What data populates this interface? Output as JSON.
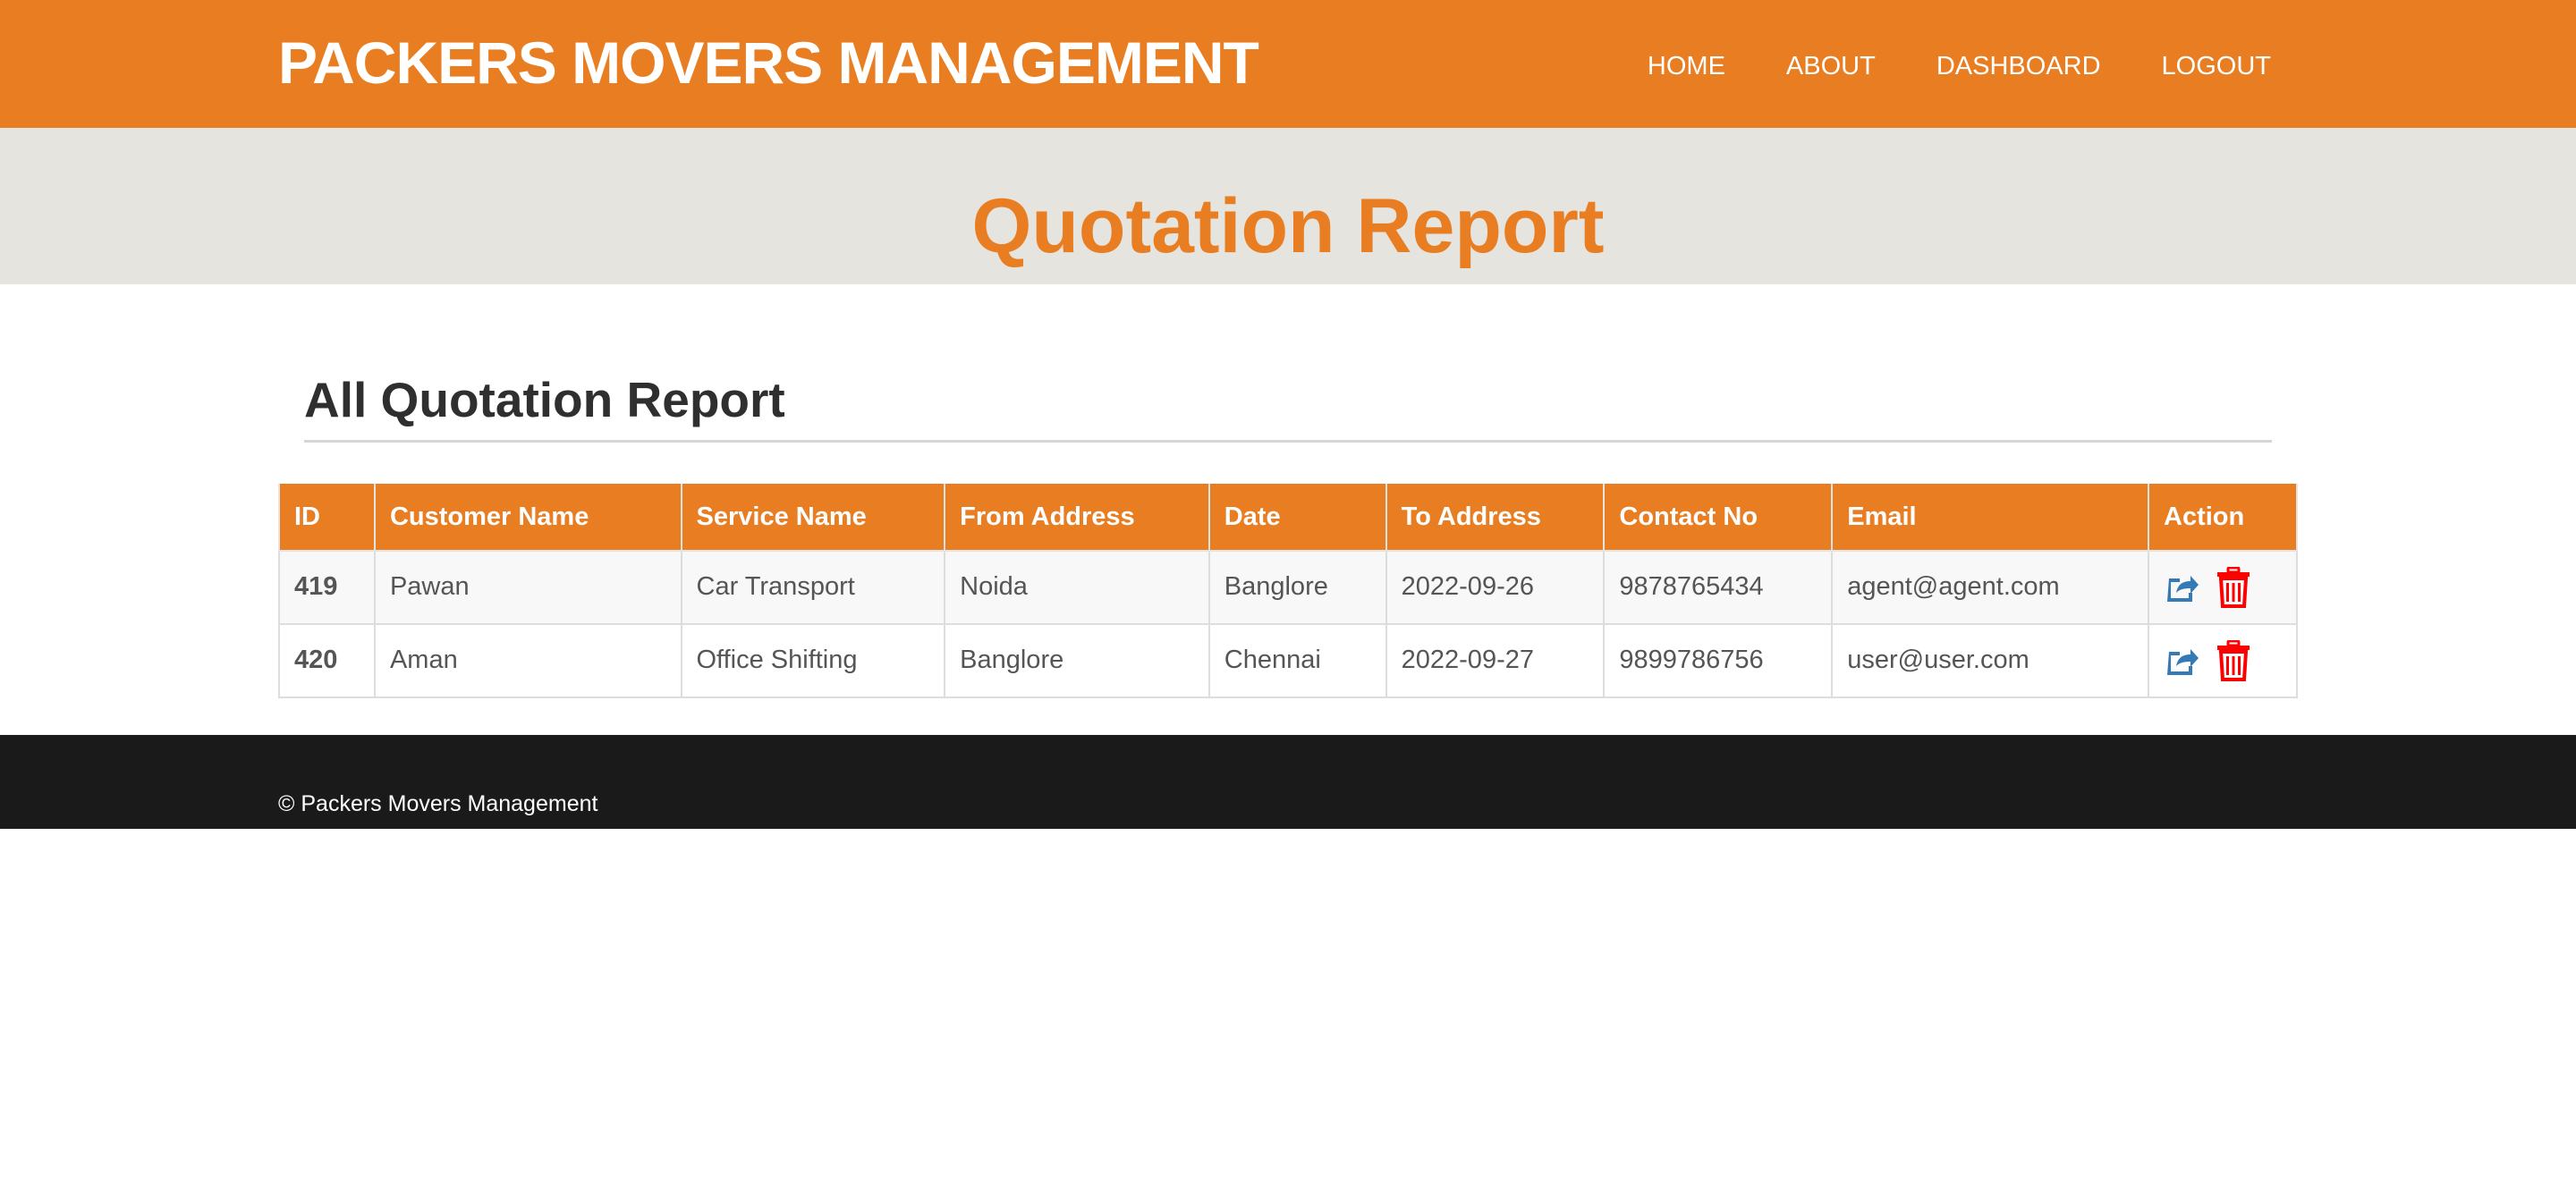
{
  "header": {
    "brand": "PACKERS MOVERS MANAGEMENT",
    "nav": [
      "HOME",
      "ABOUT",
      "DASHBOARD",
      "LOGOUT"
    ]
  },
  "banner": {
    "title": "Quotation Report"
  },
  "main": {
    "section_title": "All Quotation Report",
    "table": {
      "columns": [
        "ID",
        "Customer Name",
        "Service Name",
        "From Address",
        "Date",
        "To Address",
        "Contact No",
        "Email",
        "Action"
      ],
      "rows": [
        {
          "id": "419",
          "customer": "Pawan",
          "service": "Car Transport",
          "from": "Noida",
          "date": "Banglore",
          "to": "2022-09-26",
          "contact": "9878765434",
          "email": "agent@agent.com"
        },
        {
          "id": "420",
          "customer": "Aman",
          "service": "Office Shifting",
          "from": "Banglore",
          "date": "Chennai",
          "to": "2022-09-27",
          "contact": "9899786756",
          "email": "user@user.com"
        }
      ]
    }
  },
  "footer": {
    "copyright": "© Packers Movers Management"
  },
  "colors": {
    "accent": "#e87d22",
    "banner_bg": "#e5e4df",
    "footer_bg": "#1a1a1a",
    "edit_icon": "#337ab7",
    "delete_icon": "#ff0000"
  },
  "icons": {
    "edit": "share-square-icon",
    "delete": "trash-icon"
  }
}
